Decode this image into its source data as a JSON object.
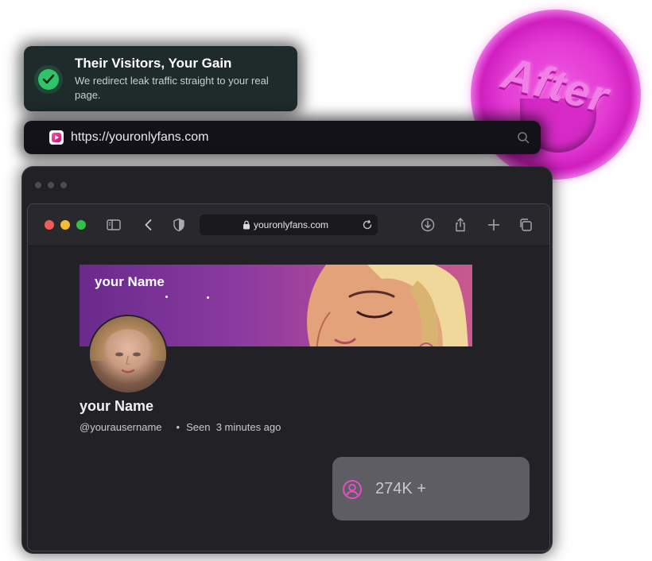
{
  "badge": {
    "label": "After"
  },
  "notification": {
    "title": "Their Visitors, Your Gain",
    "description": "We redirect leak traffic straight to your real page."
  },
  "url_bar": {
    "url": "https://youronlyfans.com"
  },
  "browser": {
    "address": "youronlyfans.com"
  },
  "profile": {
    "banner_name": "your Name",
    "name": "your Name",
    "username": "@yourausername",
    "separator": "•",
    "seen_label": "Seen",
    "seen_time": "3 minutes ago"
  },
  "stat": {
    "value": "274K +"
  },
  "colors": {
    "accent_pink": "#e33ad3",
    "success_green": "#2fc46a",
    "stat_icon": "#e54fc4"
  }
}
